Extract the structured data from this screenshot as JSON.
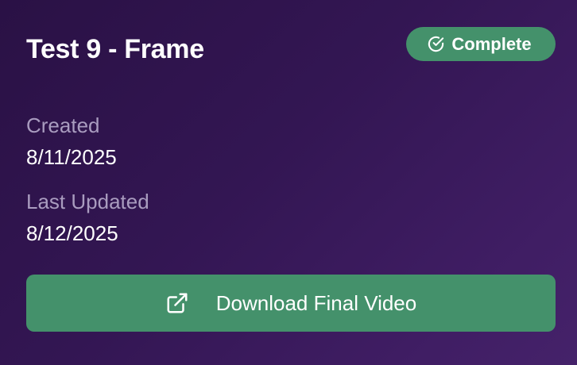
{
  "project": {
    "title": "Test 9 - Frame",
    "status": {
      "label": "Complete",
      "icon": "check-circle-icon",
      "color": "#44916b"
    }
  },
  "meta": {
    "created_label": "Created",
    "created_value": "8/11/2025",
    "updated_label": "Last Updated",
    "updated_value": "8/12/2025"
  },
  "actions": {
    "download_label": "Download Final Video",
    "download_icon": "external-link-icon",
    "accent_color": "#44916b"
  }
}
